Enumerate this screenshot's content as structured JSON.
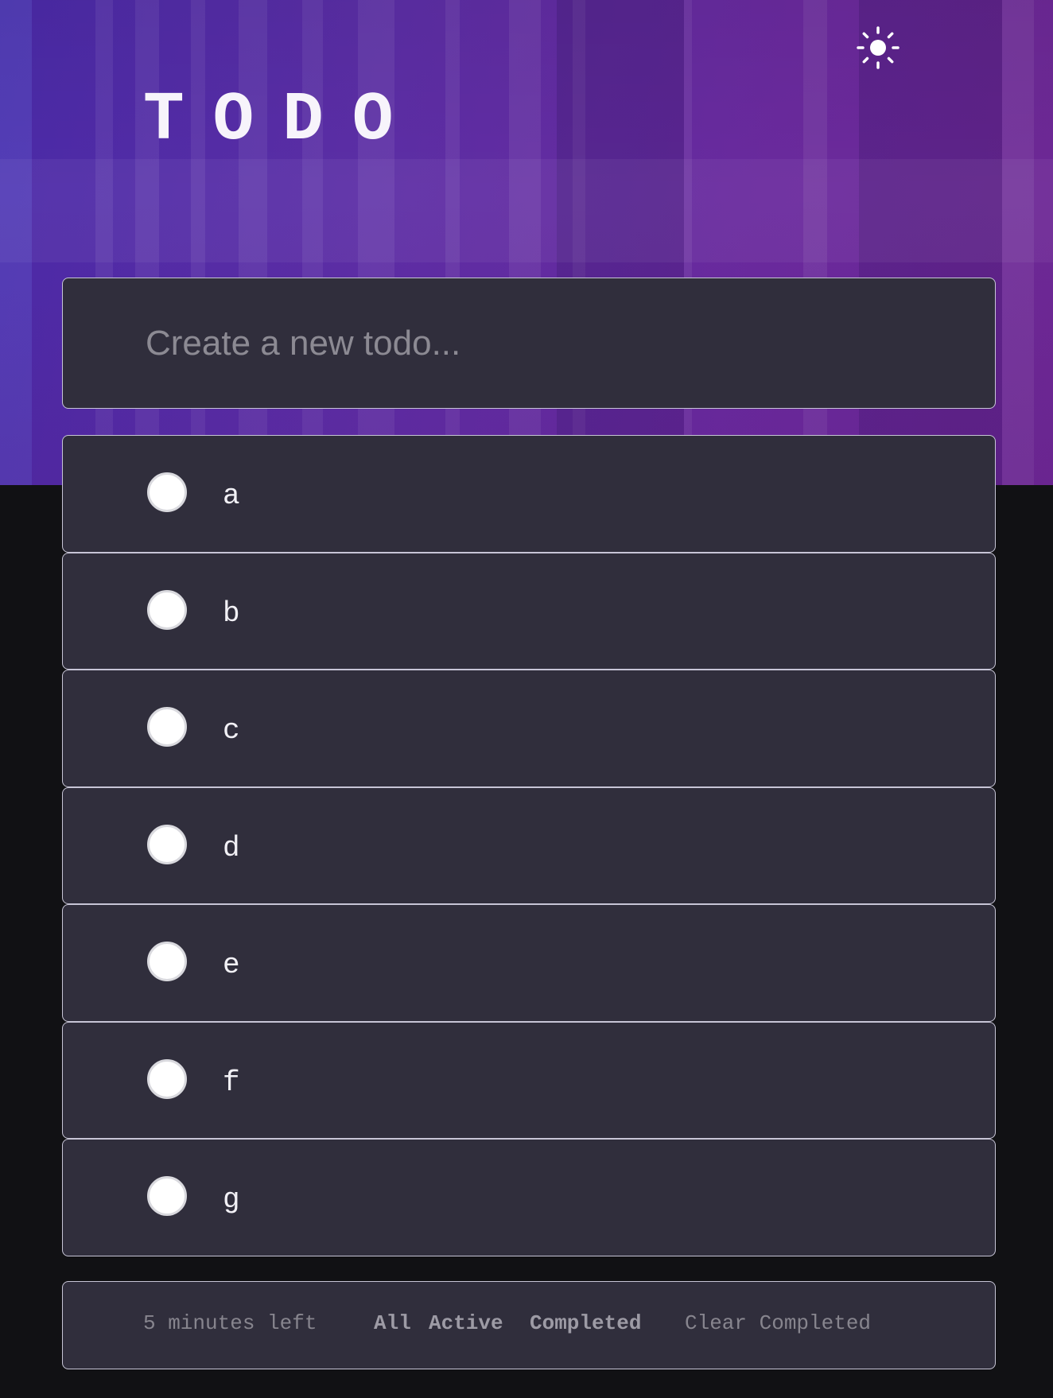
{
  "header": {
    "title": "TODO",
    "theme_icon": "sun-icon"
  },
  "new_todo": {
    "placeholder": "Create a new todo...",
    "value": ""
  },
  "todos": [
    {
      "text": "a",
      "completed": false
    },
    {
      "text": "b",
      "completed": false
    },
    {
      "text": "c",
      "completed": false
    },
    {
      "text": "d",
      "completed": false
    },
    {
      "text": "e",
      "completed": false
    },
    {
      "text": "f",
      "completed": false
    },
    {
      "text": "g",
      "completed": false
    }
  ],
  "footer": {
    "items_left": "5 minutes left",
    "filters": [
      "All",
      "Active",
      "Completed"
    ],
    "clear_label": "Clear Completed"
  },
  "colors": {
    "background": "#111114",
    "card": "#302e3c",
    "card_border": "#c7c5d6",
    "hero_start": "#4a2aa8",
    "hero_end": "#6e2894",
    "text": "#f2f1f6",
    "muted": "#87858e"
  }
}
